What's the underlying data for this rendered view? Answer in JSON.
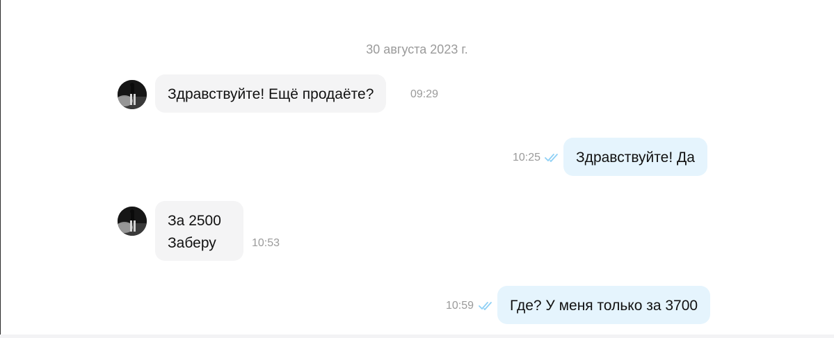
{
  "chat": {
    "date_separator": "30 августа 2023 г.",
    "messages": [
      {
        "direction": "incoming",
        "lines": [
          "Здравствуйте! Ещё продаёте?"
        ],
        "time": "09:29"
      },
      {
        "direction": "outgoing",
        "lines": [
          "Здравствуйте! Да"
        ],
        "time": "10:25",
        "status": "read"
      },
      {
        "direction": "incoming",
        "lines": [
          "За 2500",
          "Заберу"
        ],
        "time": "10:53"
      },
      {
        "direction": "outgoing",
        "lines": [
          "Где? У меня только за 3700"
        ],
        "time": "10:59",
        "status": "read"
      }
    ]
  },
  "colors": {
    "incoming_bubble": "#f4f4f5",
    "outgoing_bubble": "#e5f4fd",
    "timestamp": "#9a9a9a",
    "read_check": "#8fd0f5"
  },
  "icons": {
    "read_status": "double-check-icon",
    "sender_avatar": "avatar"
  }
}
